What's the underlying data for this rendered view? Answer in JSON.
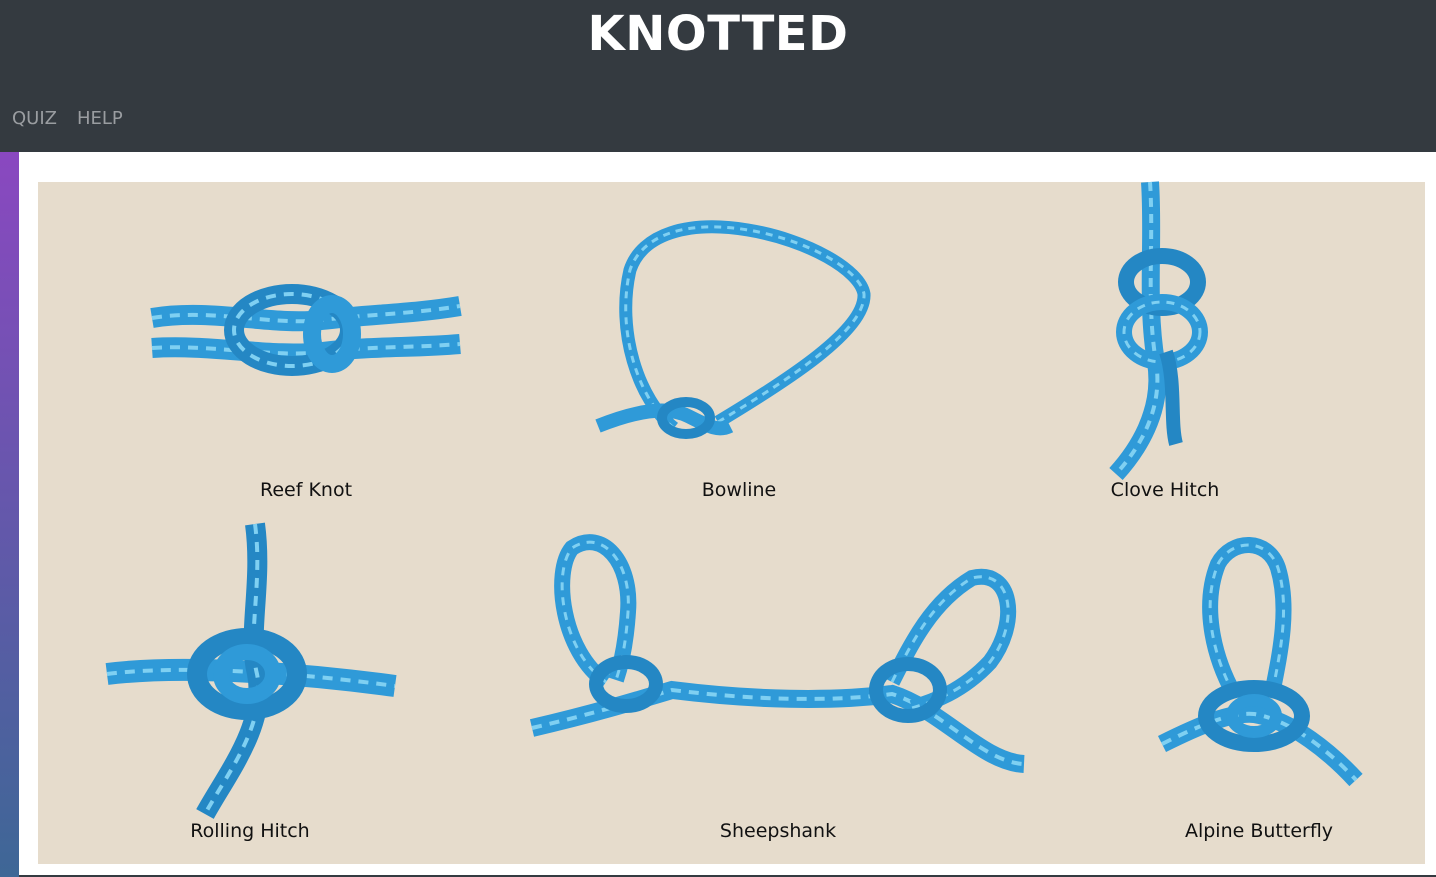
{
  "header": {
    "title": "KNOTTED",
    "nav": [
      {
        "label": "QUIZ"
      },
      {
        "label": "HELP"
      }
    ]
  },
  "colors": {
    "header_bg": "#343a40",
    "nav_text": "#9a9da1",
    "gallery_bg": "#e6dccc",
    "rope_blue": "#2f9ad8",
    "rope_highlight": "#7fd0f2",
    "sidebar_gradient_top": "#8a48c0",
    "sidebar_gradient_bottom": "#3e6796"
  },
  "knots": [
    {
      "label": "Reef Knot",
      "icon": "reef-knot-rope-image"
    },
    {
      "label": "Bowline",
      "icon": "bowline-rope-image"
    },
    {
      "label": "Clove Hitch",
      "icon": "clove-hitch-rope-image"
    },
    {
      "label": "Rolling Hitch",
      "icon": "rolling-hitch-rope-image"
    },
    {
      "label": "Sheepshank",
      "icon": "sheepshank-rope-image"
    },
    {
      "label": "Alpine Butterfly",
      "icon": "alpine-butterfly-rope-image"
    }
  ]
}
